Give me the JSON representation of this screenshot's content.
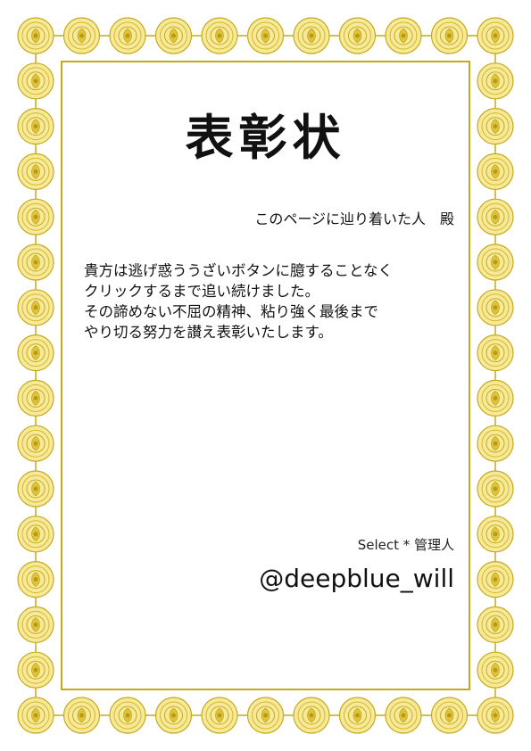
{
  "certificate": {
    "title": "表彰状",
    "recipient": "このページに辿り着いた人　殿",
    "body_lines": [
      "貴方は逃げ惑ううざいボタンに臆することなく",
      "クリックするまで追い続けました。",
      "その諦めない不屈の精神、粘り強く最後まで",
      "やり切る努力を讃え表彰いたします。"
    ],
    "signer_role": "Select * 管理人",
    "signer_handle": "@deepblue_will"
  },
  "colors": {
    "border_gold": "#c7a91a",
    "border_light": "#f3e27a",
    "text": "#111111"
  }
}
